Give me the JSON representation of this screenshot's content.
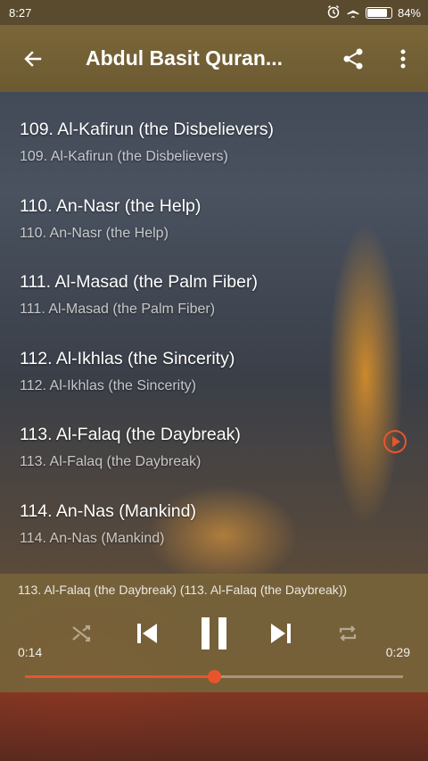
{
  "status": {
    "time": "8:27",
    "battery": "84%",
    "battery_level": 0.84
  },
  "appbar": {
    "title": "Abdul Basit Quran..."
  },
  "list": {
    "items": [
      {
        "title": "109. Al-Kafirun (the Disbelievers)",
        "subtitle": "109. Al-Kafirun (the Disbelievers)"
      },
      {
        "title": "110. An-Nasr (the Help)",
        "subtitle": "110. An-Nasr (the Help)"
      },
      {
        "title": "111. Al-Masad (the Palm Fiber)",
        "subtitle": "111. Al-Masad (the Palm Fiber)"
      },
      {
        "title": "112. Al-Ikhlas (the Sincerity)",
        "subtitle": "112. Al-Ikhlas (the Sincerity)"
      },
      {
        "title": "113. Al-Falaq (the Daybreak)",
        "subtitle": "113. Al-Falaq (the Daybreak)"
      },
      {
        "title": "114. An-Nas (Mankind)",
        "subtitle": "114. An-Nas (Mankind)"
      }
    ]
  },
  "player": {
    "now_playing": "113. Al-Falaq (the Daybreak) (113. Al-Falaq (the Daybreak))",
    "elapsed": "0:14",
    "total": "0:29",
    "progress": 0.5,
    "accent_color": "#e8552d"
  }
}
